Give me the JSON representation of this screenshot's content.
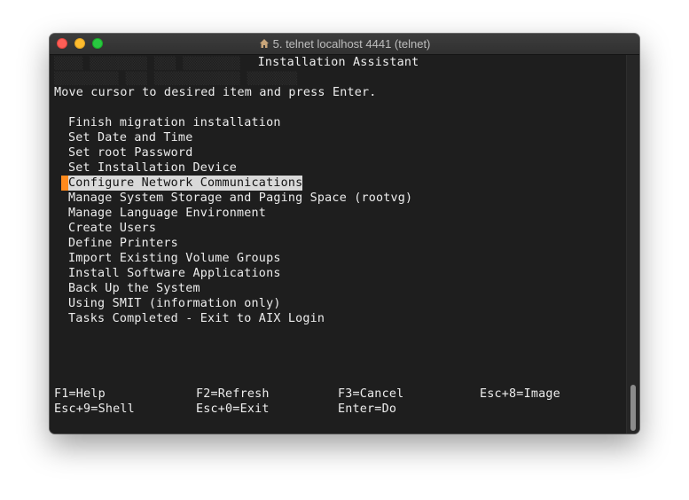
{
  "window": {
    "title": "5. telnet localhost 4441 (telnet)"
  },
  "screen": {
    "heading": "Installation Assistant",
    "prompt": "Move cursor to desired item and press Enter.",
    "menu": [
      "Finish migration installation",
      "Set Date and Time",
      "Set root Password",
      "Set Installation Device",
      "Configure Network Communications",
      "Manage System Storage and Paging Space (rootvg)",
      "Manage Language Environment",
      "Create Users",
      "Define Printers",
      "Import Existing Volume Groups",
      "Install Software Applications",
      "Back Up the System",
      "Using SMIT (information only)",
      "Tasks Completed - Exit to AIX Login"
    ],
    "selected_index": 4
  },
  "fkeys": {
    "row1": [
      "F1=Help",
      "F2=Refresh",
      "F3=Cancel",
      "Esc+8=Image"
    ],
    "row2": [
      "Esc+9=Shell",
      "Esc+0=Exit",
      "Enter=Do"
    ]
  },
  "colors": {
    "cursor": "#ff8a1c",
    "terminal_bg": "#1e1e1e",
    "text": "#ededed",
    "selection_bg": "#d9d9d9"
  }
}
